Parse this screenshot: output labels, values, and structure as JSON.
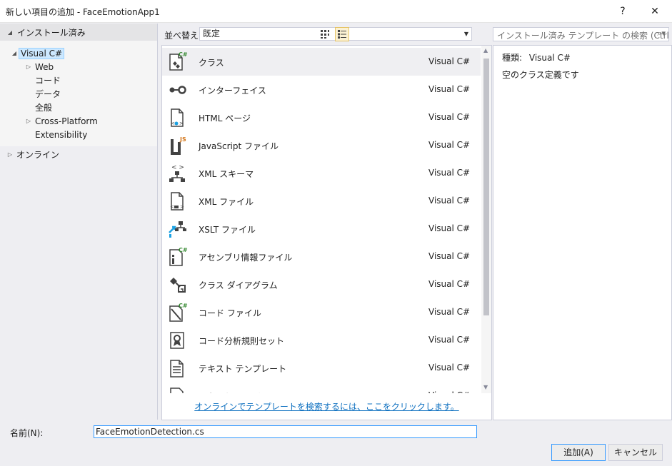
{
  "window": {
    "title": "新しい項目の追加 - FaceEmotionApp1",
    "help_label": "?",
    "close_label": "✕"
  },
  "left_panel": {
    "header": "インストール済み",
    "tree": [
      {
        "label": "Visual C#",
        "expander": "◢",
        "level": 1,
        "selected": true
      },
      {
        "label": "Web",
        "expander": "▷",
        "level": 2
      },
      {
        "label": "コード",
        "expander": "",
        "level": 2
      },
      {
        "label": "データ",
        "expander": "",
        "level": 2
      },
      {
        "label": "全般",
        "expander": "",
        "level": 2
      },
      {
        "label": "Cross-Platform",
        "expander": "▷",
        "level": 2
      },
      {
        "label": "Extensibility",
        "expander": "",
        "level": 2
      }
    ],
    "online": {
      "label": "オンライン",
      "expander": "▷"
    }
  },
  "toolbar": {
    "sort_label": "並べ替え:",
    "sort_value": "既定",
    "search_placeholder": "インストール済み テンプレート の検索 (Ctrl+E"
  },
  "templates": [
    {
      "name": "クラス",
      "lang": "Visual C#",
      "icon": "class-icon",
      "selected": true
    },
    {
      "name": "インターフェイス",
      "lang": "Visual C#",
      "icon": "interface-icon"
    },
    {
      "name": "HTML ページ",
      "lang": "Visual C#",
      "icon": "html-page-icon"
    },
    {
      "name": "JavaScript ファイル",
      "lang": "Visual C#",
      "icon": "javascript-file-icon"
    },
    {
      "name": "XML スキーマ",
      "lang": "Visual C#",
      "icon": "xml-schema-icon"
    },
    {
      "name": "XML ファイル",
      "lang": "Visual C#",
      "icon": "xml-file-icon"
    },
    {
      "name": "XSLT ファイル",
      "lang": "Visual C#",
      "icon": "xslt-file-icon"
    },
    {
      "name": "アセンブリ情報ファイル",
      "lang": "Visual C#",
      "icon": "assembly-info-icon"
    },
    {
      "name": "クラス ダイアグラム",
      "lang": "Visual C#",
      "icon": "class-diagram-icon"
    },
    {
      "name": "コード ファイル",
      "lang": "Visual C#",
      "icon": "code-file-icon"
    },
    {
      "name": "コード分析規則セット",
      "lang": "Visual C#",
      "icon": "ruleset-icon"
    },
    {
      "name": "テキスト テンプレート",
      "lang": "Visual C#",
      "icon": "text-template-icon"
    },
    {
      "name": "テキスト ファイル",
      "lang": "Visual C#",
      "icon": "text-file-icon"
    }
  ],
  "online_link": "オンラインでテンプレートを検索するには、ここをクリックします。",
  "details": {
    "kind_label": "種類:",
    "kind_value": "Visual C#",
    "description": "空のクラス定義です"
  },
  "bottom": {
    "name_label": "名前(N):",
    "name_value": "FaceEmotionDetection.cs",
    "add_label": "追加(A)",
    "cancel_label": "キャンセル"
  },
  "colors": {
    "accent": "#3399ff",
    "link": "#0e70c0",
    "icon_dark": "#424242",
    "icon_green": "#388a34",
    "icon_orange": "#d37519",
    "icon_blue": "#1ba1e2"
  }
}
